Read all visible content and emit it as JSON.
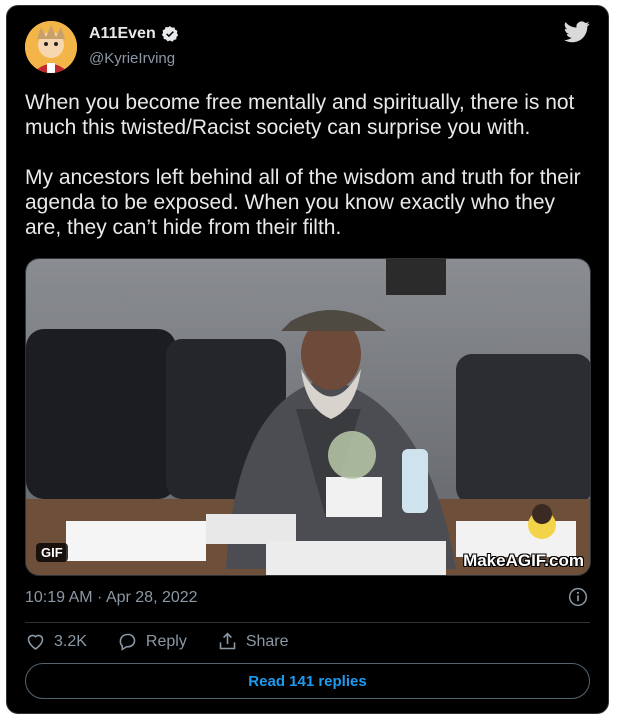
{
  "author": {
    "display_name": "A11Even",
    "handle": "@KyrieIrving"
  },
  "tweet": {
    "paragraphs": [
      "When you become free mentally and spiritually, there is not much this twisted/Racist society can surprise you with.",
      "My ancestors left behind all of the wisdom and truth for their agenda to be exposed. When you know exactly who they are, they can’t hide from their filth."
    ],
    "timestamp": "10:19 AM · Apr 28, 2022"
  },
  "media": {
    "badge": "GIF",
    "watermark": "MakeAGIF.com"
  },
  "actions": {
    "likes": "3.2K",
    "reply_label": "Reply",
    "share_label": "Share"
  },
  "footer": {
    "read_replies": "Read 141 replies"
  },
  "colors": {
    "background": "#000000",
    "text": "#e7e9ea",
    "secondary": "#8b98a5",
    "accent": "#1d9bf0",
    "border": "#2f3336"
  }
}
